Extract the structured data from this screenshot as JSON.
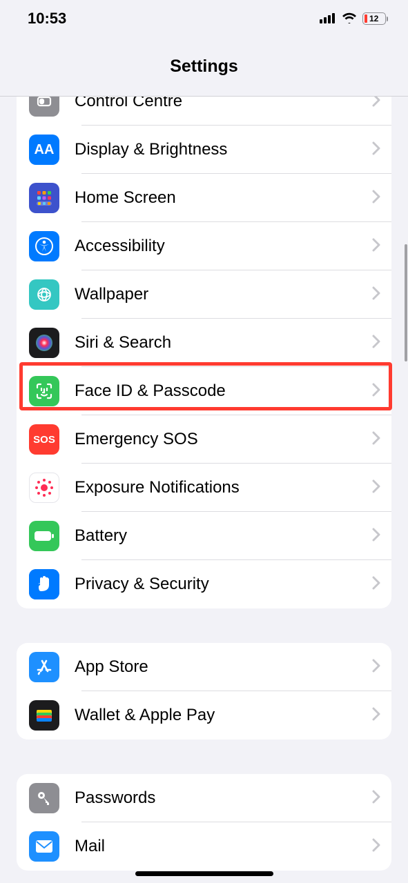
{
  "status": {
    "time": "10:53",
    "battery_pct": "12"
  },
  "header": {
    "title": "Settings"
  },
  "rows": {
    "control_centre": {
      "label": "Control Centre"
    },
    "display": {
      "label": "Display & Brightness"
    },
    "home_screen": {
      "label": "Home Screen"
    },
    "accessibility": {
      "label": "Accessibility"
    },
    "wallpaper": {
      "label": "Wallpaper"
    },
    "siri": {
      "label": "Siri & Search"
    },
    "faceid": {
      "label": "Face ID & Passcode"
    },
    "sos": {
      "label": "Emergency SOS",
      "icon_text": "SOS"
    },
    "exposure": {
      "label": "Exposure Notifications"
    },
    "battery": {
      "label": "Battery"
    },
    "privacy": {
      "label": "Privacy & Security"
    },
    "app_store": {
      "label": "App Store"
    },
    "wallet": {
      "label": "Wallet & Apple Pay"
    },
    "passwords": {
      "label": "Passwords"
    },
    "mail": {
      "label": "Mail"
    }
  }
}
